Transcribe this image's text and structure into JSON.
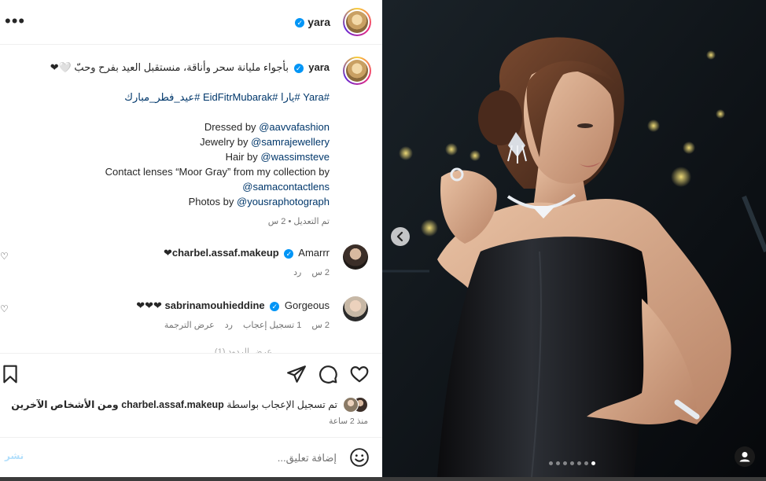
{
  "header": {
    "username": "yara",
    "more_label": "•••"
  },
  "caption": {
    "username": "yara",
    "text": "بأجواء مليانة سحر وأناقة، منستقبل العيد بفرح وحبّ 🤍❤",
    "hashtags": "#Yara #يارا #EidFitrMubarak #عيد_فطر_مبارك",
    "credits": [
      {
        "prefix": "Dressed by ",
        "handle": "@aavvafashion"
      },
      {
        "prefix": "Jewelry by ",
        "handle": "@samrajewellery"
      },
      {
        "prefix": "Hair by ",
        "handle": "@wassimsteve"
      },
      {
        "prefix": "Contact lenses “Moor Gray” from my collection by",
        "handle": ""
      },
      {
        "prefix": "",
        "handle": "@samacontactlens"
      },
      {
        "prefix": "Photos by ",
        "handle": "@yousraphotograph"
      }
    ],
    "meta": "تم التعديل • 2 س"
  },
  "comments": [
    {
      "username": "charbel.assaf.makeup",
      "text": "Amarrr❤",
      "time": "2 س",
      "reply": "رد"
    },
    {
      "username": "sabrinamouhieddine",
      "text": "Gorgeous ❤❤❤",
      "time": "2 س",
      "likes": "1 تسجيل إعجاب",
      "reply": "رد",
      "translate": "عرض الترجمة"
    }
  ],
  "view_replies": "عرض الردود (1)",
  "likes_line": {
    "prefix": "تم تسجيل الإعجاب بواسطة",
    "user": "charbel.assaf.makeup",
    "suffix": "ومن الأشخاص الآخرين"
  },
  "post_time": "منذ 2 ساعة",
  "add_comment": {
    "placeholder": "إضافة تعليق...",
    "post_label": "نشر"
  },
  "carousel": {
    "total": 7,
    "active_index": 6
  },
  "colors": {
    "verified": "#0095f6",
    "link": "#00376b"
  }
}
